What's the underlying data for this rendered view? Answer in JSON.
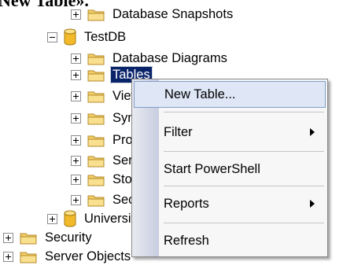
{
  "caption": "New Table».",
  "tree": {
    "database_snapshots": "Database Snapshots",
    "testdb": "TestDB",
    "database_diagrams": "Database Diagrams",
    "tables": "Tables",
    "views": "Views",
    "synonyms": "Synor",
    "programmability": "Progr",
    "service_broker": "Servi",
    "storage": "Stora",
    "security_db": "Secu",
    "university": "University",
    "security": "Security",
    "server_objects": "Server Objects"
  },
  "context_menu": {
    "new_table": "New Table...",
    "filter": "Filter",
    "start_powershell": "Start PowerShell",
    "reports": "Reports",
    "refresh": "Refresh"
  },
  "colors": {
    "selection": "#0a246a",
    "menu_highlight": "#dfe7f6",
    "folder": "#f3cf68",
    "database": "#f2b92a"
  },
  "icons": {
    "folder": "folder-icon",
    "database": "database-icon",
    "submenu": "submenu-arrow-icon"
  }
}
